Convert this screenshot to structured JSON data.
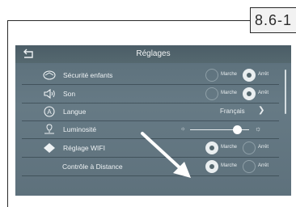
{
  "page_tag": "8.6-1",
  "screen": {
    "title": "Réglages",
    "rows": [
      {
        "label": "Sécurité enfants",
        "icon": "car-shield-icon",
        "type": "toggle",
        "on_label": "Marche",
        "off_label": "Arrêt",
        "selected": "off"
      },
      {
        "label": "Son",
        "icon": "speaker-icon",
        "type": "toggle",
        "on_label": "Marche",
        "off_label": "Arrêt",
        "selected": "off"
      },
      {
        "label": "Langue",
        "icon": "language-icon",
        "type": "select",
        "value": "Français"
      },
      {
        "label": "Luminosité",
        "icon": "brightness-icon",
        "type": "slider",
        "level": 0.8
      },
      {
        "label": "Réglage WIFI",
        "icon": "wifi-diamond-icon",
        "type": "toggle",
        "on_label": "Marche",
        "off_label": "Arrêt",
        "selected": "on"
      },
      {
        "label": "Contrôle à Distance",
        "icon": "",
        "type": "toggle",
        "on_label": "Marche",
        "off_label": "Arrêt",
        "selected": "on"
      }
    ]
  },
  "colors": {
    "screen_bg": "#617580",
    "header_bg": "#4f616b",
    "text": "#eef2f4"
  }
}
